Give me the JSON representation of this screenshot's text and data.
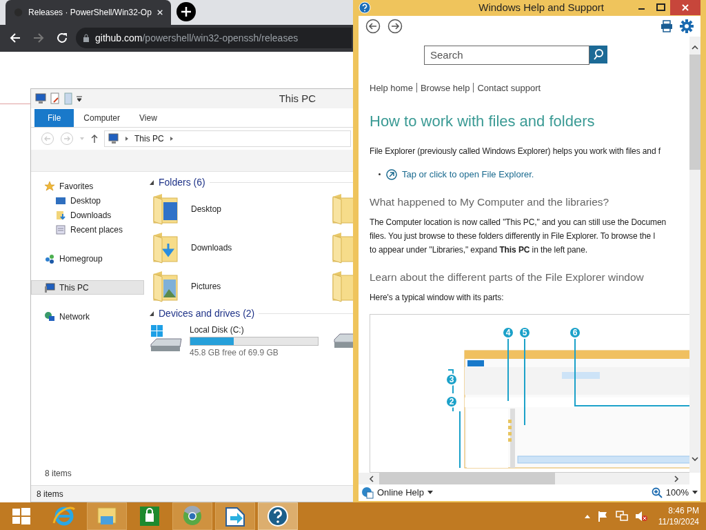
{
  "browser": {
    "tab_title": "Releases · PowerShell/Win32-Op",
    "url_domain": "github.com",
    "url_path": "/powershell/win32-openssh/releases"
  },
  "explorer": {
    "title": "This PC",
    "ribbon_tabs": [
      {
        "label": "File",
        "selected": true
      },
      {
        "label": "Computer",
        "selected": false
      },
      {
        "label": "View",
        "selected": false
      }
    ],
    "breadcrumb": [
      "This PC"
    ],
    "nav": [
      {
        "label": "Favorites",
        "kind": "favorites",
        "selected": false,
        "children": [
          {
            "label": "Desktop",
            "kind": "desktop",
            "selected": false
          },
          {
            "label": "Downloads",
            "kind": "downloads",
            "selected": false
          },
          {
            "label": "Recent places",
            "kind": "recent",
            "selected": false
          }
        ]
      },
      {
        "label": "Homegroup",
        "kind": "homegroup",
        "selected": false
      },
      {
        "label": "This PC",
        "kind": "pc",
        "selected": true
      },
      {
        "label": "Network",
        "kind": "network",
        "selected": false
      }
    ],
    "folders_title": "Folders (6)",
    "folders": [
      {
        "label": "Desktop",
        "kind": "desktop"
      },
      {
        "label": "Downloads",
        "kind": "downloads"
      },
      {
        "label": "Pictures",
        "kind": "pictures"
      }
    ],
    "drives_title": "Devices and drives (2)",
    "drives": [
      {
        "label": "Local Disk (C:)",
        "level": 0.34,
        "reading": "45.8 GB free of 69.9 GB"
      }
    ],
    "item_count": "8 items",
    "status": "8 items"
  },
  "help": {
    "title": "Windows Help and Support",
    "search": {
      "placeholder": "Search"
    },
    "links": [
      "Help home",
      "Browse help",
      "Contact support"
    ],
    "heading": "How to work with files and folders",
    "intro": "File Explorer (previously called Windows Explorer) helps you work with files and f",
    "bullet_link": "Tap or click to open File Explorer.",
    "sections": [
      {
        "heading": "What happened to My Computer and the libraries?",
        "lines": [
          "The Computer location is now called \"This PC,\" and you can still use the Documen",
          "files. You just browse to these folders differently in File Explorer. To browse the l",
          "to appear under \"Libraries,\" expand **This PC** in the left pane."
        ]
      },
      {
        "heading": "Learn about the different parts of the File Explorer window",
        "lines": [
          "Here's a typical window with its parts:"
        ]
      }
    ],
    "callouts": [
      "4",
      "5",
      "6",
      "3",
      "2"
    ],
    "footer": "Online Help",
    "zoom": "100%"
  },
  "taskbar": {
    "apps": [
      {
        "kind": "start",
        "open": false,
        "selected": false
      },
      {
        "kind": "ie",
        "open": false,
        "selected": false
      },
      {
        "kind": "explorer",
        "open": true,
        "selected": false
      },
      {
        "kind": "store",
        "open": false,
        "selected": false
      },
      {
        "kind": "chrome",
        "open": true,
        "selected": false
      },
      {
        "kind": "remote",
        "open": true,
        "selected": false
      },
      {
        "kind": "help",
        "open": true,
        "selected": true
      }
    ],
    "time": "8:46 PM",
    "date": "11/19/2024"
  }
}
